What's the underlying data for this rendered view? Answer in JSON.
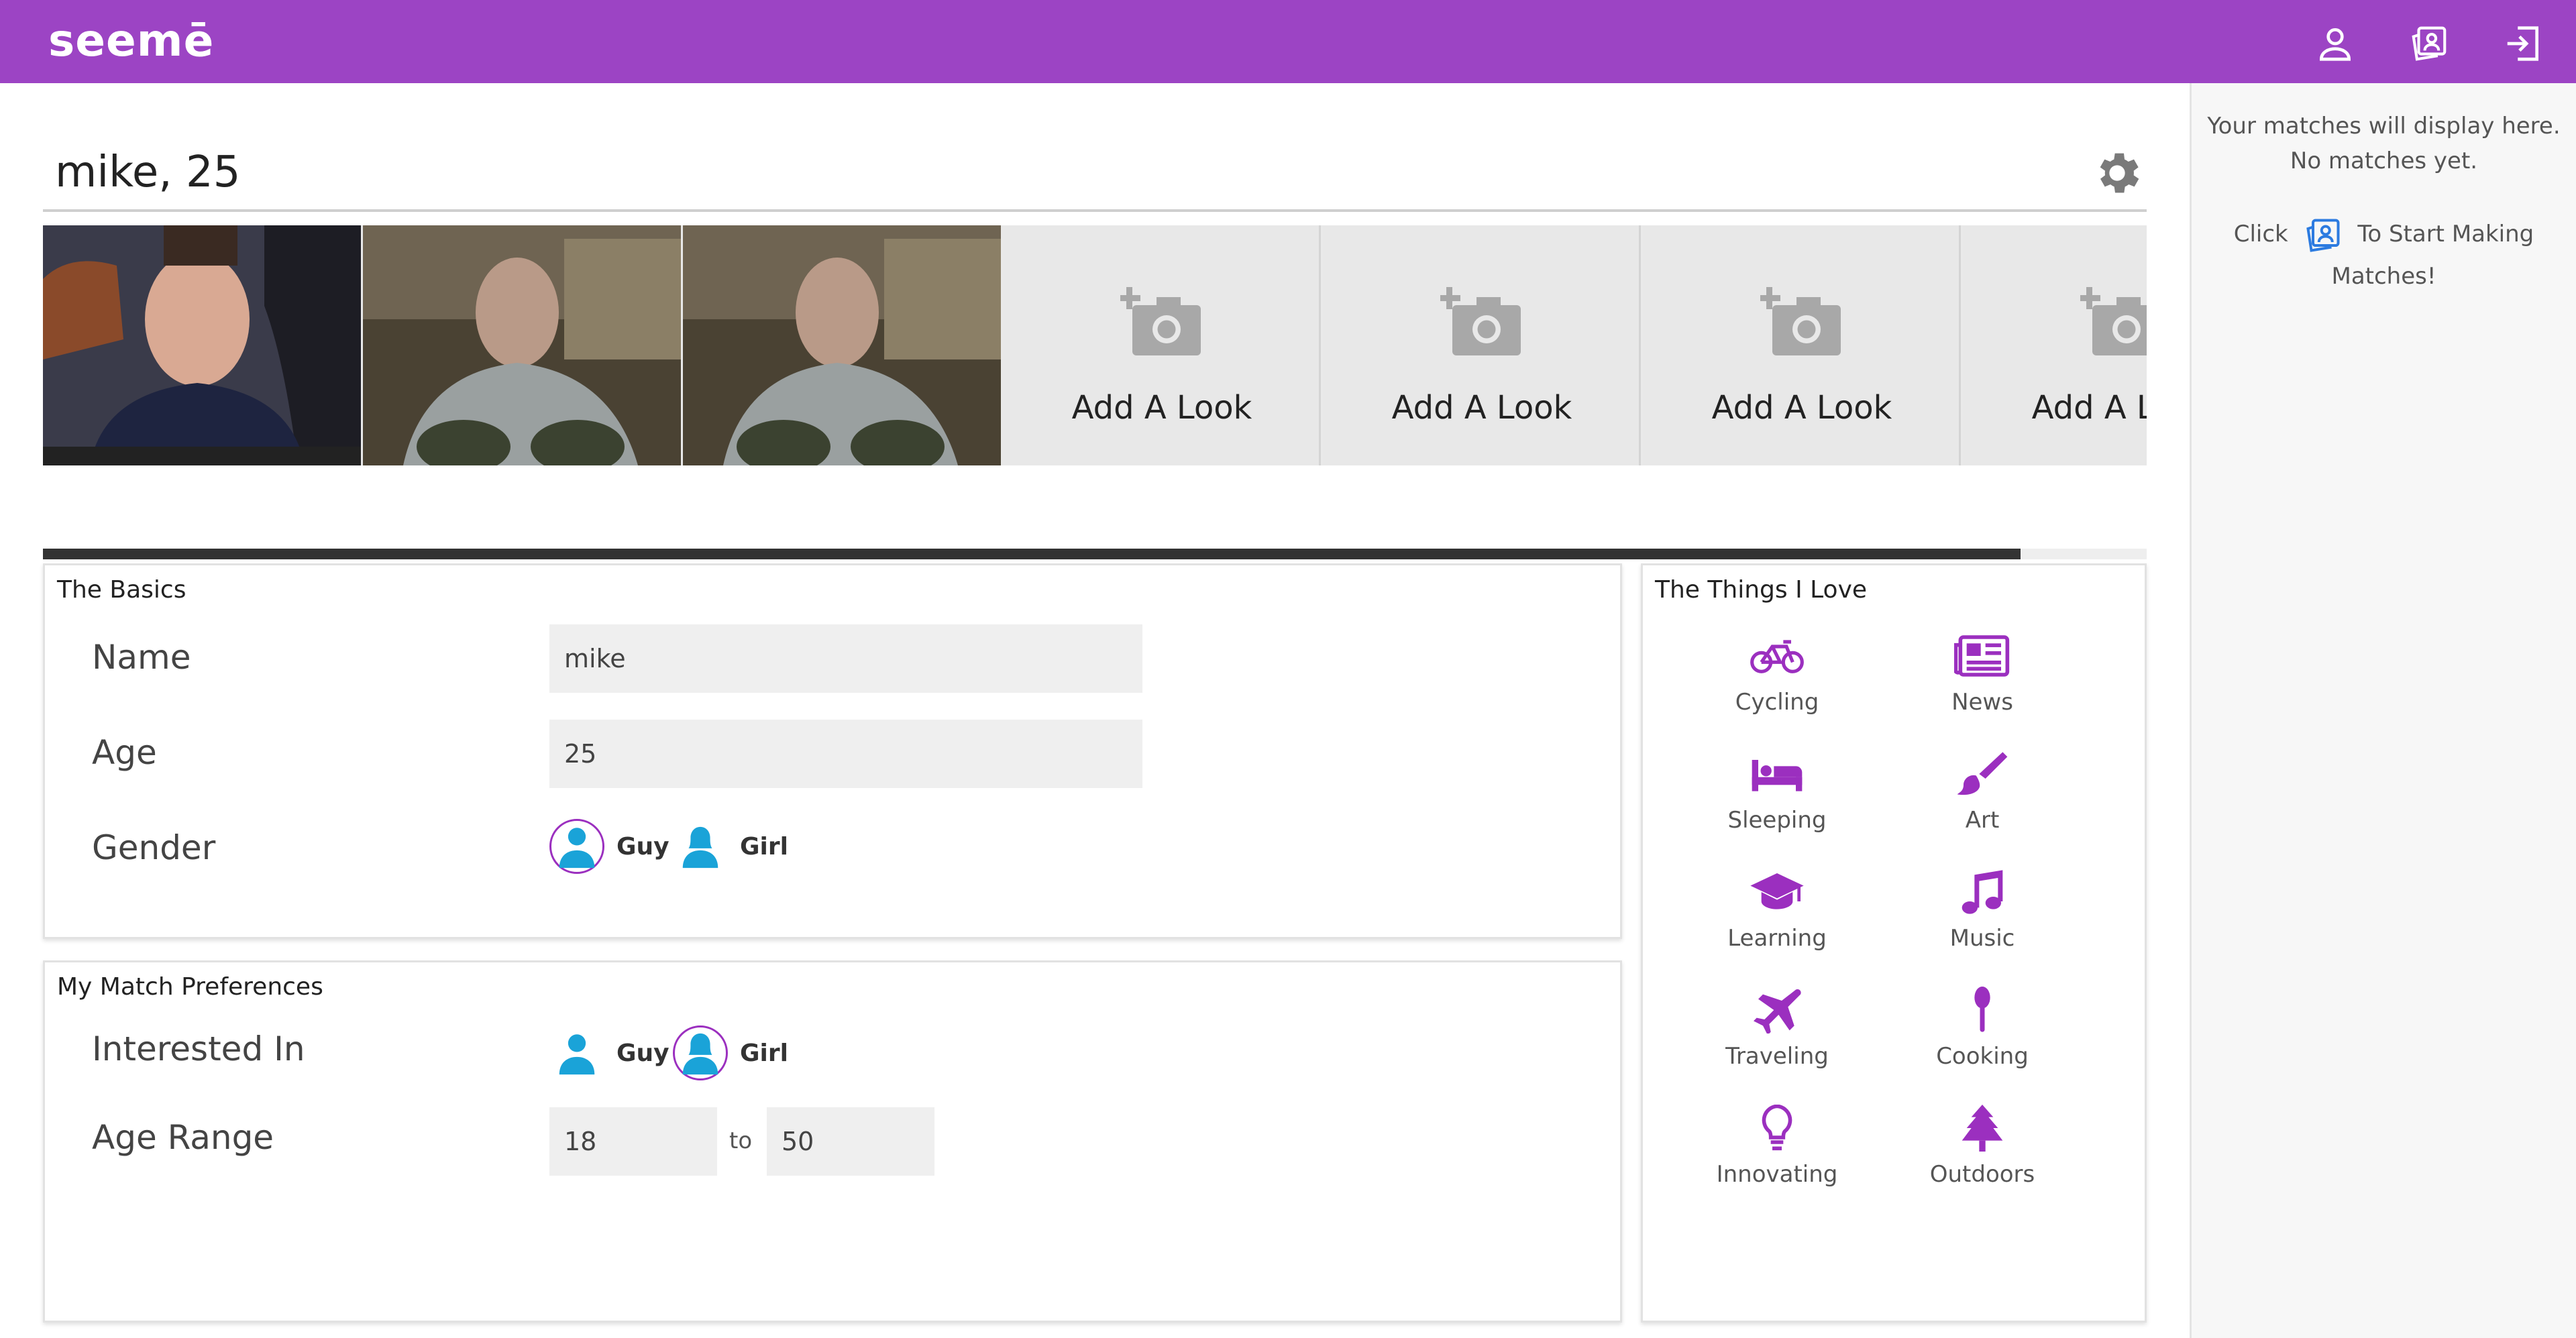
{
  "app": {
    "logo": "seemē"
  },
  "nav": {
    "profile_icon": "person-icon",
    "matches_icon": "contact-cards-icon",
    "logout_icon": "exit-icon"
  },
  "profile": {
    "title": "mike, 25",
    "settings_icon": "gear-icon",
    "looks": [
      {
        "type": "photo",
        "delete_icon": "trash-icon"
      },
      {
        "type": "photo",
        "delete_icon": "trash-icon"
      },
      {
        "type": "photo",
        "delete_icon": "trash-icon"
      },
      {
        "type": "empty",
        "label": "Add A Look"
      },
      {
        "type": "empty",
        "label": "Add A Look"
      },
      {
        "type": "empty",
        "label": "Add A Look"
      },
      {
        "type": "empty",
        "label": "Add A Look"
      }
    ],
    "looks_scroll_fraction": 0.94
  },
  "basics": {
    "title": "The Basics",
    "name_label": "Name",
    "name_value": "mike",
    "age_label": "Age",
    "age_value": "25",
    "gender_label": "Gender",
    "gender_options": [
      {
        "label": "Guy",
        "selected": true
      },
      {
        "label": "Girl",
        "selected": false
      }
    ]
  },
  "prefs": {
    "title": "My Match Preferences",
    "interested_label": "Interested In",
    "interested_options": [
      {
        "label": "Guy",
        "selected": false
      },
      {
        "label": "Girl",
        "selected": true
      }
    ],
    "age_range_label": "Age Range",
    "age_min": "18",
    "to_label": "to",
    "age_max": "50"
  },
  "things": {
    "title": "The Things I Love",
    "items": [
      {
        "label": "Cycling",
        "icon": "bicycle-icon"
      },
      {
        "label": "News",
        "icon": "newspaper-icon"
      },
      {
        "label": "Sleeping",
        "icon": "bed-icon"
      },
      {
        "label": "Art",
        "icon": "paintbrush-icon"
      },
      {
        "label": "Learning",
        "icon": "graduation-cap-icon"
      },
      {
        "label": "Music",
        "icon": "music-note-icon"
      },
      {
        "label": "Traveling",
        "icon": "airplane-icon"
      },
      {
        "label": "Cooking",
        "icon": "spoon-icon"
      },
      {
        "label": "Innovating",
        "icon": "lightbulb-icon"
      },
      {
        "label": "Outdoors",
        "icon": "tree-icon"
      }
    ]
  },
  "sidebar": {
    "empty_line1": "Your matches will display here.",
    "empty_line2": "No matches yet.",
    "hint_prefix": "Click",
    "hint_suffix": "To Start Making",
    "hint_line2": "Matches!"
  },
  "colors": {
    "brand": "#9c44c4",
    "accent_purple": "#9b2fbf",
    "avatar_blue": "#1aa3d8",
    "link_blue": "#2c7be0"
  }
}
